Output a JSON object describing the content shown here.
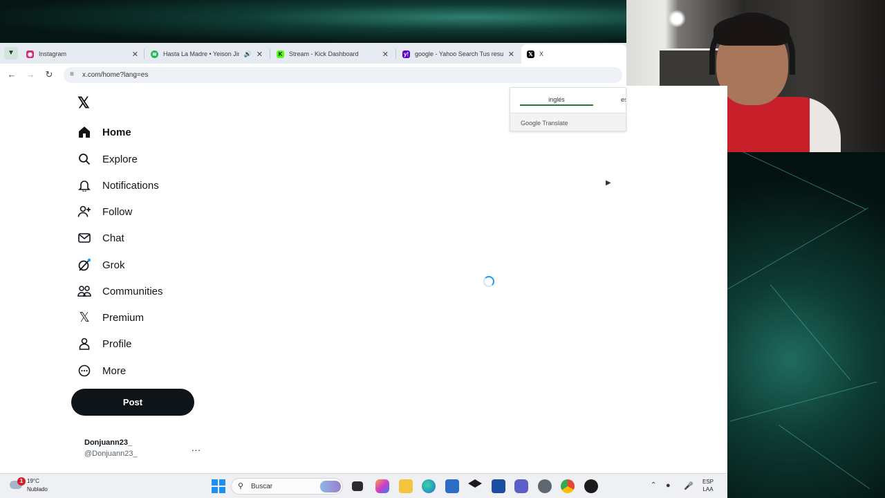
{
  "browser": {
    "tabs": [
      {
        "label": "Instagram",
        "icon": "instagram-icon",
        "color": "#d62976"
      },
      {
        "label": "Hasta La Madre • Yeison Jiménez",
        "icon": "spotify-icon",
        "color": "#1db954",
        "audio_icon": "speaker-icon"
      },
      {
        "label": "Stream - Kick Dashboard",
        "icon": "kick-icon",
        "color": "#53fc18"
      },
      {
        "label": "google - Yahoo Search Tus resultados",
        "icon": "yahoo-icon",
        "color": "#6001d2"
      },
      {
        "label": "X",
        "icon": "x-icon",
        "color": "#000000"
      }
    ],
    "url": "x.com/home?lang=es"
  },
  "translate": {
    "lang_source": "inglés",
    "lang_target": "es",
    "brand": "Google Translate"
  },
  "nav": {
    "items": [
      {
        "label": "Home",
        "icon": "home-icon",
        "active": true
      },
      {
        "label": "Explore",
        "icon": "search-icon"
      },
      {
        "label": "Notifications",
        "icon": "bell-icon"
      },
      {
        "label": "Follow",
        "icon": "follow-icon"
      },
      {
        "label": "Chat",
        "icon": "mail-icon"
      },
      {
        "label": "Grok",
        "icon": "grok-icon"
      },
      {
        "label": "Communities",
        "icon": "communities-icon"
      },
      {
        "label": "Premium",
        "icon": "x-premium-icon"
      },
      {
        "label": "Profile",
        "icon": "person-icon"
      },
      {
        "label": "More",
        "icon": "more-circle-icon"
      }
    ],
    "post_label": "Post"
  },
  "account": {
    "name": "Donjuann23_",
    "handle": "@Donjuann23_",
    "more": "..."
  },
  "taskbar": {
    "weather_temp": "19°C",
    "weather_condition": "Nublado",
    "weather_badge": "1",
    "search_placeholder": "Buscar",
    "lang_top": "ESP",
    "lang_bottom": "LAA"
  },
  "colors": {
    "x_black": "#0f1419",
    "spinner_blue": "#1d9bf0",
    "translate_green": "#1e7a3c"
  }
}
